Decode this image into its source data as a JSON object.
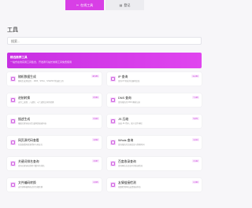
{
  "tabs": [
    {
      "label": "在线工具",
      "icon": "tools-icon"
    },
    {
      "label": "登记",
      "icon": "clipboard-icon"
    }
  ],
  "page_title": "工具",
  "search": {
    "placeholder": "搜索..."
  },
  "banner": {
    "title": "精选推荐工具",
    "text": "一站式在线实用工具集合，开发者与站长常用工具免费使用"
  },
  "cards": [
    {
      "title": "随机数据生成",
      "desc": "随机生成测试用 ... MD5、SHA1、SHA256 等加密工具",
      "badge": "48,956"
    },
    {
      "title": "IP 查询",
      "desc": "查询 IP 地址的归属地信息",
      "badge": "11,260"
    },
    {
      "title": "进制转换",
      "desc": "支持二进制、八进制、十六进制之间的转换",
      "badge": "8,563"
    },
    {
      "title": "DNS 查询",
      "desc": "查询域名的 DNS 解析记录",
      "badge": "7,126"
    },
    {
      "title": "描述生成",
      "desc": "根据关键词自动生成网页描述内容",
      "badge": "6,940"
    },
    {
      "title": "JS 压缩",
      "desc": "压缩 JS 代码，减少文件体积",
      "badge": "5,871"
    },
    {
      "title": "网页源代码查看",
      "desc": "在线查看网页源代码与响应头",
      "badge": "4,802"
    },
    {
      "title": "Whois 查询",
      "desc": "查询域名的注册信息与到期时间",
      "badge": "4,214"
    },
    {
      "title": "关键词排名查询",
      "desc": "查询关键词在搜索引擎中的排名",
      "badge": "3,667"
    },
    {
      "title": "百度收录查询",
      "desc": "查询网站在百度中的收录情况",
      "badge": "3,102"
    },
    {
      "title": "文件编码转换",
      "desc": "支持多种编码格式的互相转换",
      "badge": "2,845"
    },
    {
      "title": "友情链接检测",
      "desc": "批量检测网站友情链接状态",
      "badge": "2,390"
    }
  ]
}
